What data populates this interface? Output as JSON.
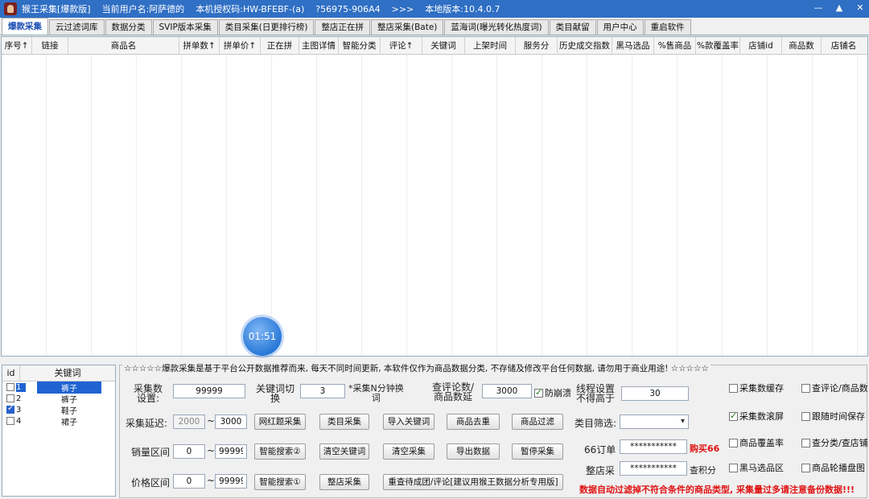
{
  "titlebar": {
    "app": "猴王采集[爆款版]",
    "user": "当前用户名:阿萨德的",
    "machine": "本机授权码:HW-BFEBF-(a)",
    "code": "?56975-906A4",
    "arrows": ">>>",
    "version": "本地版本:10.4.0.7",
    "minimize": "—",
    "maximize": "▲",
    "close": "✕"
  },
  "tabs": [
    "爆款采集",
    "云过滤词库",
    "数据分类",
    "SVIP版本采集",
    "类目采集(日更排行榜)",
    "整店正在拼",
    "整店采集(Bate)",
    "蓝海词(曝光转化热度词)",
    "类目献留",
    "用户中心",
    "重启软件"
  ],
  "grid": {
    "columns": [
      "序号↑",
      "链接",
      "商品名",
      "拼单数↑",
      "拼单价↑",
      "正在拼",
      "主图详情",
      "智能分类",
      "评论↑",
      "关键词",
      "上架时间",
      "服务分",
      "历史成交指数",
      "黑马选品",
      "%售商品",
      "%款覆盖率",
      "店铺id",
      "商品数",
      "店铺名"
    ]
  },
  "timer": "01:51",
  "keywords": {
    "header_id": "id",
    "header_kw": "关键词",
    "rows": [
      {
        "id": "1",
        "kw": "裤子",
        "checked": false,
        "selected": true
      },
      {
        "id": "2",
        "kw": "裤子",
        "checked": false,
        "selected": false
      },
      {
        "id": "3",
        "kw": "鞋子",
        "checked": true,
        "selected": false
      },
      {
        "id": "4",
        "kw": "裙子",
        "checked": false,
        "selected": false
      }
    ]
  },
  "notice": "☆☆☆☆☆爆款采集是基于平台公开数据推荐而来, 每天不同时间更新, 本软件仅作为商品数据分类, 不存储及修改平台任何数据, 请勿用于商业用途! ☆☆☆☆☆",
  "settings": {
    "collect_count_label": "采集数\n设置:",
    "collect_count_value": "99999",
    "kw_switch_label": "关键词切\n换",
    "kw_switch_value": "3",
    "kw_switch_suffix": "*采集N分钟换\n词",
    "review_label": "查评论数/\n商品数延",
    "review_value": "3000",
    "anti_crash": "防崩溃",
    "thread_label": "线程设置\n不得高于",
    "thread_value": "30",
    "delay_label": "采集延迟:",
    "delay_min": "2000",
    "delay_max": "3000",
    "dash": "~",
    "sales_label": "销量区间",
    "sales_min": "0",
    "sales_max": "999999",
    "price_label": "价格区间",
    "price_min": "0",
    "price_max": "999999",
    "category_label": "类目筛选:",
    "order66_label": "66订单",
    "order66_value": "***********",
    "buy66": "购买66",
    "shop_label": "整店采",
    "shop_value": "***********",
    "check_points": "查积分",
    "warning": "数据自动过滤掉不符合条件的商品类型, 采集量过多请注意备份数据!!!",
    "buttons": {
      "wangzhan": "网红题采集",
      "category": "类目采集",
      "import_kw": "导入关键词",
      "dedupe": "商品去重",
      "filter": "商品过滤",
      "smart1": "智能搜索②",
      "clear_kw": "清空关键词",
      "clear_collect": "清空采集",
      "export": "导出数据",
      "pause": "暂停采集",
      "smart2": "智能搜索①",
      "shop_collect": "整店采集",
      "recheck": "重查待成团/评论[建议用猴王数据分析专用版]"
    },
    "checks": {
      "cache": "采集数缓存",
      "review_goods": "查评论/商品数",
      "scroll": "采集数滚屏",
      "timed_save": "跟随时间保存",
      "coverage": "商品覆盖率",
      "cat_shop": "查分类/查店铺",
      "darkhorse": "黑马选品区",
      "carousel": "商品轮播盘图"
    }
  }
}
